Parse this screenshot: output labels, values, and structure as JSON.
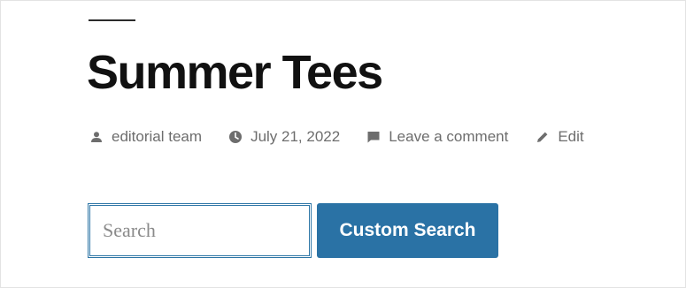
{
  "post": {
    "title": "Summer Tees",
    "meta": {
      "author": "editorial team",
      "date": "July 21, 2022",
      "comment_link": "Leave a comment",
      "edit_link": "Edit",
      "icons": {
        "author": "person-icon",
        "date": "clock-icon",
        "comment": "comment-icon",
        "edit": "pencil-icon"
      }
    }
  },
  "search": {
    "placeholder": "Search",
    "value": "",
    "button_label": "Custom Search"
  },
  "colors": {
    "accent": "#2a72a5",
    "text": "#111111",
    "muted": "#6d6d6d"
  }
}
